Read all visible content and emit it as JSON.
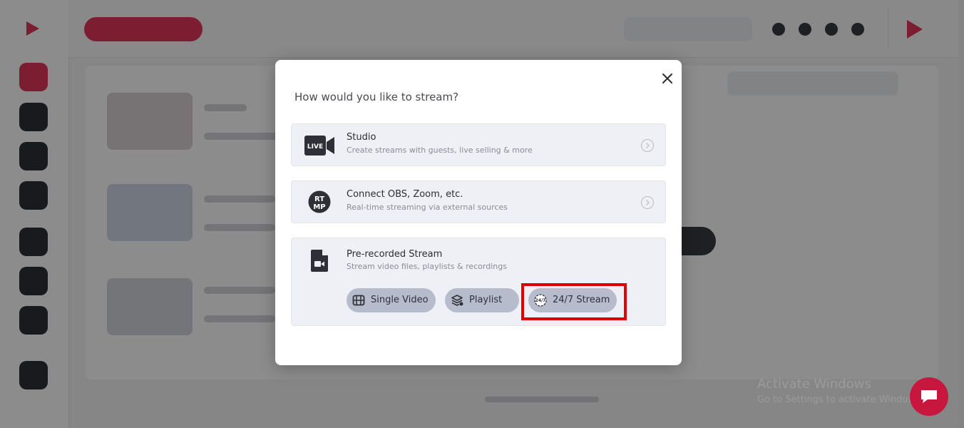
{
  "background": {
    "create_button_label": ""
  },
  "modal": {
    "title": "How would you like to stream?",
    "options": [
      {
        "title": "Studio",
        "subtitle": "Create streams with guests, live selling & more",
        "icon": "live-camera-icon",
        "icon_text": "LIVE"
      },
      {
        "title": "Connect OBS, Zoom, etc.",
        "subtitle": "Real-time streaming via external sources",
        "icon": "rtmp-icon",
        "icon_text_top": "RT",
        "icon_text_bottom": "MP"
      },
      {
        "title": "Pre-recorded Stream",
        "subtitle": "Stream video files, playlists & recordings",
        "icon": "video-file-icon"
      }
    ],
    "prerecorded_buttons": [
      {
        "label": "Single Video",
        "icon": "film-icon"
      },
      {
        "label": "Playlist",
        "icon": "layers-icon"
      },
      {
        "label": "24/7 Stream",
        "icon": "clock-247-icon",
        "icon_text": "24/7"
      }
    ]
  },
  "watermark": {
    "line1": "Activate Windows",
    "line2": "Go to Settings to activate Windows."
  },
  "colors": {
    "accent": "#e2365a",
    "chip_bg": "#b7bccc",
    "option_bg": "#eef0f5",
    "highlight": "#e00000",
    "chat": "#c8173f"
  }
}
